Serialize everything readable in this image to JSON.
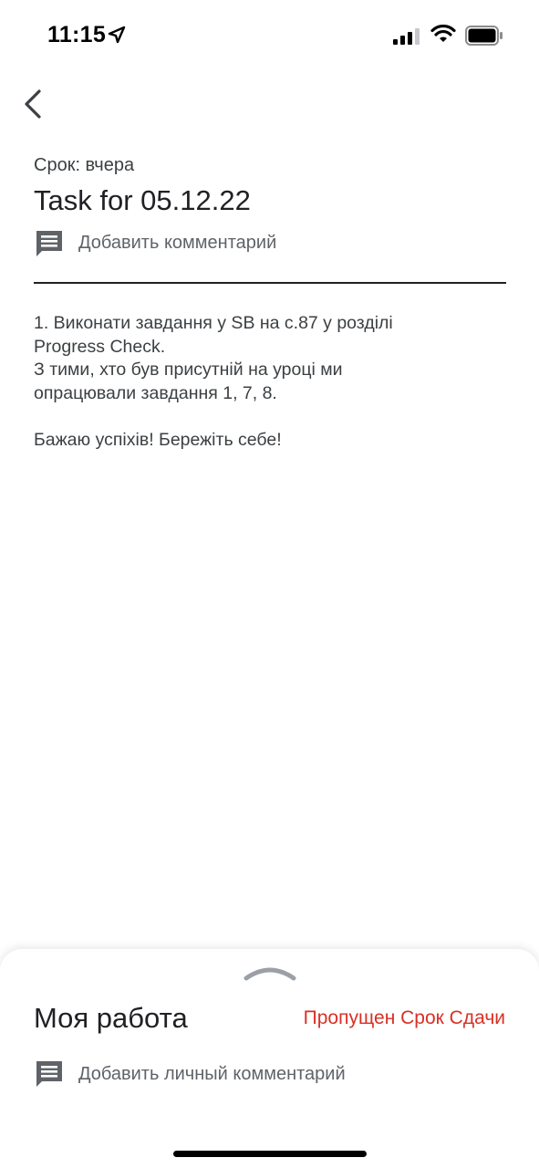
{
  "status_bar": {
    "time": "11:15",
    "icons": [
      "location-arrow-icon",
      "cellular-signal-icon",
      "wifi-icon",
      "battery-icon"
    ]
  },
  "nav": {
    "back_icon": "chevron-left-icon"
  },
  "assignment": {
    "due": "Срок: вчера",
    "title": "Task for 05.12.22",
    "add_comment_label": "Добавить комментарий",
    "add_comment_icon": "comment-icon",
    "body_lines": [
      "1. Виконати завдання у SB на с.87 у розділі",
      "Progress Check.",
      "З тими, хто був присутній на уроці ми",
      "опрацювали завдання 1, 7, 8.",
      "Бажаю успіхів! Бережіть себе!"
    ]
  },
  "my_work": {
    "title": "Моя работа",
    "status": "Пропущен Срок Сдачи",
    "status_color": "#d93025",
    "add_private_comment_label": "Добавить личный комментарий",
    "add_private_comment_icon": "comment-icon",
    "handle_icon": "chevron-up-icon"
  }
}
